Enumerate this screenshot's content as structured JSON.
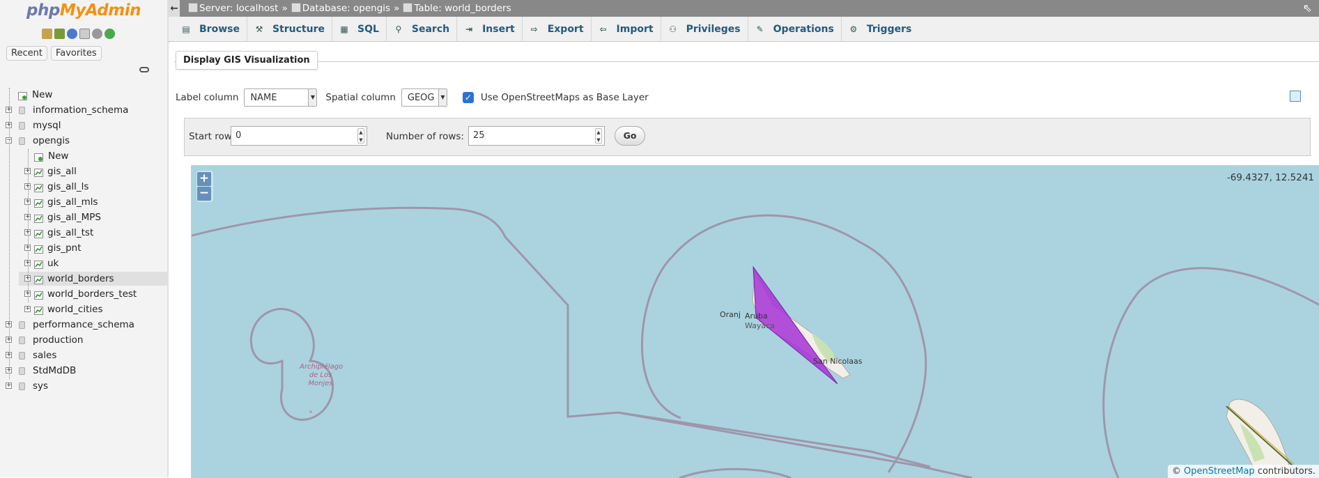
{
  "logo": {
    "part1": "php",
    "part2": "MyAdmin"
  },
  "nav": {
    "recent_label": "Recent",
    "favorites_label": "Favorites",
    "tree": [
      {
        "label": "New",
        "level": 0,
        "kind": "new"
      },
      {
        "label": "information_schema",
        "level": 0,
        "kind": "db"
      },
      {
        "label": "mysql",
        "level": 0,
        "kind": "db"
      },
      {
        "label": "opengis",
        "level": 0,
        "kind": "db-open"
      },
      {
        "label": "New",
        "level": 1,
        "kind": "new"
      },
      {
        "label": "gis_all",
        "level": 1,
        "kind": "table"
      },
      {
        "label": "gis_all_ls",
        "level": 1,
        "kind": "table"
      },
      {
        "label": "gis_all_mls",
        "level": 1,
        "kind": "table"
      },
      {
        "label": "gis_all_MPS",
        "level": 1,
        "kind": "table"
      },
      {
        "label": "gis_all_tst",
        "level": 1,
        "kind": "table"
      },
      {
        "label": "gis_pnt",
        "level": 1,
        "kind": "table"
      },
      {
        "label": "uk",
        "level": 1,
        "kind": "table"
      },
      {
        "label": "world_borders",
        "level": 1,
        "kind": "table",
        "selected": true
      },
      {
        "label": "world_borders_test",
        "level": 1,
        "kind": "table"
      },
      {
        "label": "world_cities",
        "level": 1,
        "kind": "table"
      },
      {
        "label": "performance_schema",
        "level": 0,
        "kind": "db"
      },
      {
        "label": "production",
        "level": 0,
        "kind": "db"
      },
      {
        "label": "sales",
        "level": 0,
        "kind": "db"
      },
      {
        "label": "StdMdDB",
        "level": 0,
        "kind": "db"
      },
      {
        "label": "sys",
        "level": 0,
        "kind": "db"
      }
    ]
  },
  "breadcrumb": {
    "server": "Server: localhost",
    "database": "Database: opengis",
    "table": "Table: world_borders",
    "separator": "»"
  },
  "tabs": [
    {
      "label": "Browse",
      "icon": "browse-icon"
    },
    {
      "label": "Structure",
      "icon": "structure-icon"
    },
    {
      "label": "SQL",
      "icon": "sql-icon"
    },
    {
      "label": "Search",
      "icon": "search-icon"
    },
    {
      "label": "Insert",
      "icon": "insert-icon"
    },
    {
      "label": "Export",
      "icon": "export-icon"
    },
    {
      "label": "Import",
      "icon": "import-icon"
    },
    {
      "label": "Privileges",
      "icon": "privileges-icon"
    },
    {
      "label": "Operations",
      "icon": "operations-icon"
    },
    {
      "label": "Triggers",
      "icon": "triggers-icon"
    }
  ],
  "gis": {
    "subtab": "Display GIS Visualization",
    "label_column_label": "Label column",
    "label_column_value": "NAME",
    "spatial_column_label": "Spatial column",
    "spatial_column_value": "GEOG",
    "osm_checkbox_label": "Use OpenStreetMaps as Base Layer",
    "osm_checked": true
  },
  "paging": {
    "start_row_label": "Start row:",
    "start_row_value": "0",
    "num_rows_label": "Number of rows:",
    "num_rows_value": "25",
    "go_label": "Go"
  },
  "map": {
    "zoom_in": "+",
    "zoom_out": "−",
    "coordinates": "-69.4327, 12.5241",
    "attribution_prefix": "©",
    "attribution_link": "OpenStreetMap",
    "attribution_suffix": "contributors.",
    "labels": {
      "aruba": "Aruba",
      "oranjestad": "Oranj",
      "wayaca": "Wayaca",
      "san_nicolaas": "San Nicolaas",
      "archipelago": "Archipiélago de Los Monjes"
    },
    "colors": {
      "water": "#aad3df",
      "polygon": "#a633d6",
      "border": "#9e8ba3"
    }
  }
}
